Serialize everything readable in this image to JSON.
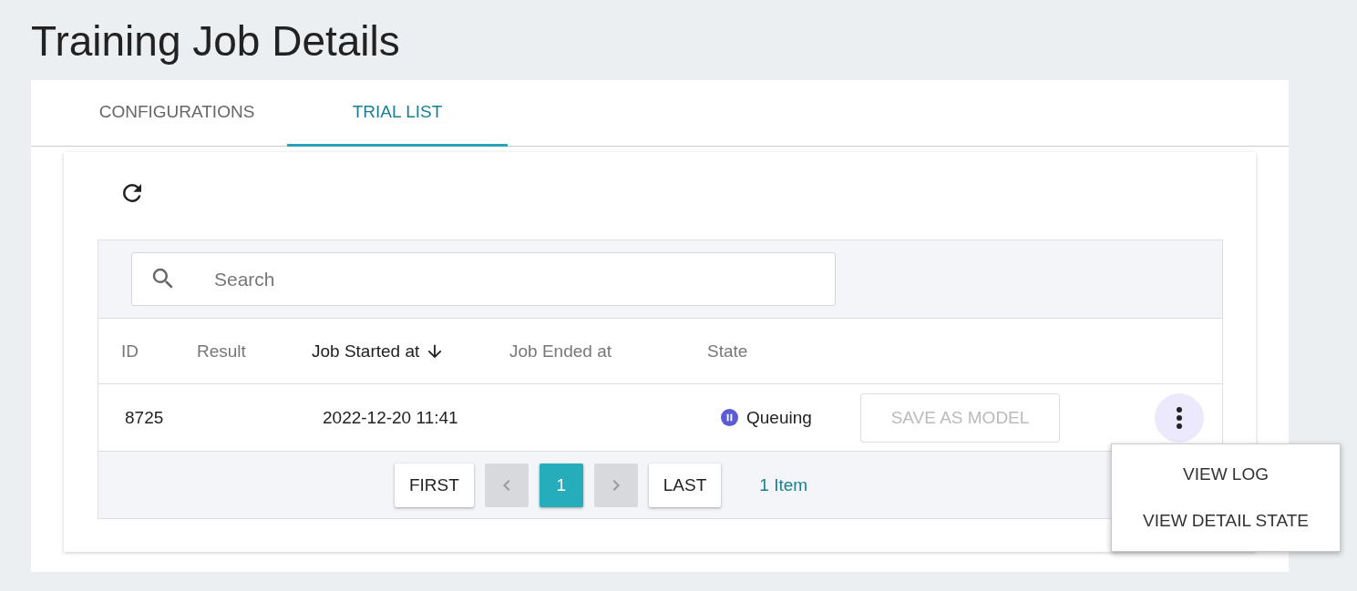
{
  "page": {
    "title": "Training Job Details"
  },
  "tabs": [
    {
      "label": "CONFIGURATIONS",
      "selected": false
    },
    {
      "label": "TRIAL LIST",
      "selected": true
    }
  ],
  "search": {
    "placeholder": "Search"
  },
  "table": {
    "columns": [
      {
        "label": "ID",
        "sorted": false
      },
      {
        "label": "Result",
        "sorted": false
      },
      {
        "label": "Job Started at",
        "sorted": true
      },
      {
        "label": "Job Ended at",
        "sorted": false
      },
      {
        "label": "State",
        "sorted": false
      }
    ],
    "rows": [
      {
        "id": "8725",
        "started": "2022-12-20 11:41",
        "state": "Queuing",
        "color": "#5b5bd6",
        "save_label": "SAVE AS MODEL",
        "save_disabled": true,
        "menu_open": true
      }
    ]
  },
  "pagination": {
    "items": [
      {
        "kind": "text",
        "label": "FIRST"
      },
      {
        "kind": "prev",
        "disabled": true
      },
      {
        "kind": "page",
        "label": "1",
        "selected": true
      },
      {
        "kind": "next",
        "disabled": true
      },
      {
        "kind": "text",
        "label": "LAST"
      }
    ],
    "count": "1 Item"
  },
  "menu": {
    "items": [
      "VIEW LOG",
      "VIEW DETAIL STATE"
    ]
  }
}
